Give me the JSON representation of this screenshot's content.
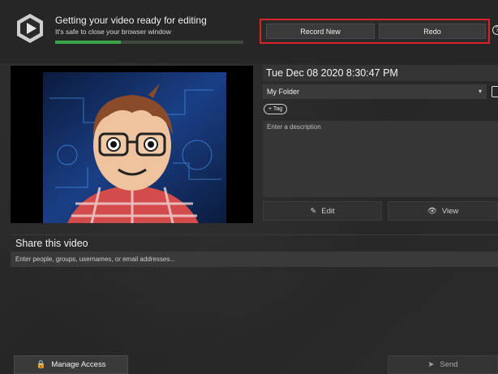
{
  "header": {
    "status_title": "Getting your video ready for editing",
    "status_subtitle": "It's safe to close your browser window",
    "progress_fraction": 0.35,
    "record_new_label": "Record New",
    "redo_label": "Redo",
    "help_icon": "help-circle-icon"
  },
  "recording": {
    "title": "Tue Dec 08 2020 8:30:47 PM",
    "folder": "My Folder",
    "tag_label": "+ Tag",
    "description_placeholder": "Enter a description",
    "edit_label": "Edit",
    "view_label": "View"
  },
  "share": {
    "title": "Share this video",
    "input_placeholder": "Enter people, groups, usernames, or email addresses...",
    "manage_access_label": "Manage Access",
    "send_label": "Send"
  },
  "colors": {
    "accent_red": "#d9232b",
    "progress_green": "#3aa44a",
    "background": "#2a2a2a"
  }
}
